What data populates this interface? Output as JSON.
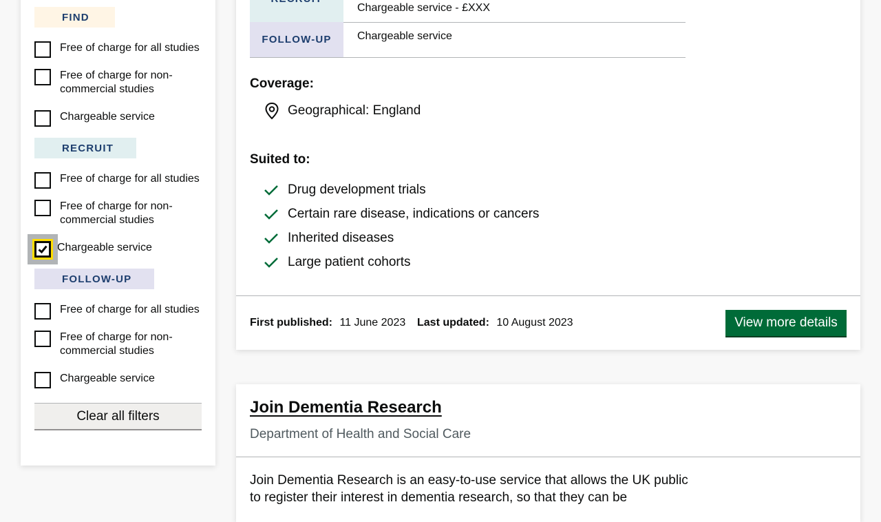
{
  "filters": {
    "groups": [
      {
        "tag": "FIND",
        "options": [
          {
            "label": "Free of charge for all studies",
            "checked": false
          },
          {
            "label": "Free of charge for non-commercial studies",
            "checked": false
          },
          {
            "label": "Chargeable service",
            "checked": false
          }
        ]
      },
      {
        "tag": "RECRUIT",
        "options": [
          {
            "label": "Free of charge for all studies",
            "checked": false
          },
          {
            "label": "Free of charge for non-commercial studies",
            "checked": false
          },
          {
            "label": "Chargeable service",
            "checked": true
          }
        ]
      },
      {
        "tag": "FOLLOW-UP",
        "options": [
          {
            "label": "Free of charge for all studies",
            "checked": false
          },
          {
            "label": "Free of charge for non-commercial studies",
            "checked": false
          },
          {
            "label": "Chargeable service",
            "checked": false
          }
        ]
      }
    ],
    "clear_label": "Clear all filters"
  },
  "card1": {
    "stages": [
      {
        "tag": "RECRUIT",
        "value": "Chargeable service - £XXX"
      },
      {
        "tag": "FOLLOW-UP",
        "value": "Chargeable service"
      }
    ],
    "coverage_heading": "Coverage:",
    "coverage_value": "Geographical: England",
    "suited_heading": "Suited to:",
    "suited_items": [
      "Drug development trials",
      "Certain rare disease, indications or cancers",
      "Inherited diseases",
      "Large patient cohorts"
    ],
    "first_published_label": "First published:",
    "first_published_value": "11 June 2023",
    "last_updated_label": "Last updated:",
    "last_updated_value": "10 August 2023",
    "view_button": "View more details"
  },
  "card2": {
    "title": "Join Dementia Research",
    "organisation": "Department of Health and Social Care",
    "description": "Join Dementia Research is an easy-to-use service that allows the UK public to register their interest in dementia research, so that they can be"
  },
  "colors": {
    "find_tag_bg": "#fff5e5",
    "recruit_tag_bg": "#e1eff0",
    "follow_tag_bg": "#e2e1f0",
    "tag_text": "#1d3e6e",
    "primary_button": "#006b38",
    "focus_yellow": "#ffdd00",
    "check_green": "#006b38"
  }
}
